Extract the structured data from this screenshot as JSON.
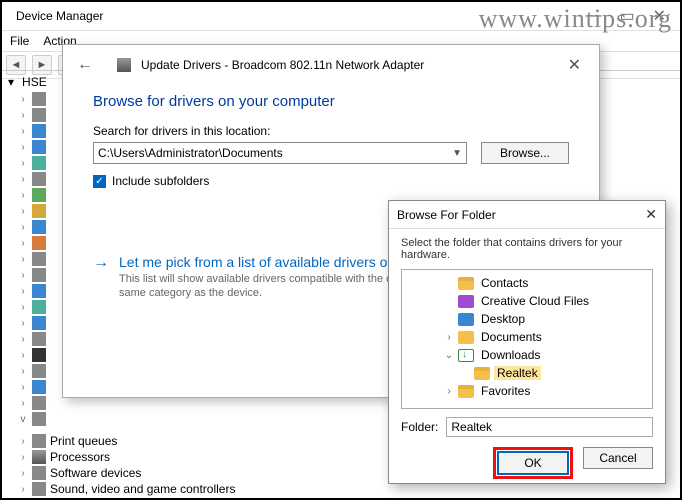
{
  "watermark": "www.wintips.org",
  "device_manager": {
    "title": "Device Manager",
    "menu": [
      "File",
      "Action"
    ],
    "root": "HSE",
    "categories_visible": [
      "Print queues",
      "Processors",
      "Software devices",
      "Sound, video and game controllers"
    ]
  },
  "update_drivers": {
    "header": "Update Drivers - Broadcom 802.11n Network Adapter",
    "heading": "Browse for drivers on your computer",
    "search_label": "Search for drivers in this location:",
    "path": "C:\\Users\\Administrator\\Documents",
    "browse_btn": "Browse...",
    "include_subfolders": "Include subfolders",
    "pick_link": "Let me pick from a list of available drivers on my computer",
    "pick_link_visible": "Let me pick from a list of available drivers o",
    "pick_sub_visible": "This list will show available drivers compatible with the de\nsame category as the device."
  },
  "browse_folder": {
    "title": "Browse For Folder",
    "msg": "Select the folder that contains drivers for your hardware.",
    "tree": [
      {
        "indent": 2,
        "icon": "folder",
        "label": "Contacts",
        "arrow": ""
      },
      {
        "indent": 2,
        "icon": "cloud",
        "label": "Creative Cloud Files",
        "arrow": ""
      },
      {
        "indent": 2,
        "icon": "desk",
        "label": "Desktop",
        "arrow": ""
      },
      {
        "indent": 2,
        "icon": "docs",
        "label": "Documents",
        "arrow": ">"
      },
      {
        "indent": 2,
        "icon": "down",
        "label": "Downloads",
        "arrow": "v"
      },
      {
        "indent": 3,
        "icon": "folder",
        "label": "Realtek",
        "arrow": "",
        "selected": true
      },
      {
        "indent": 2,
        "icon": "folder",
        "label": "Favorites",
        "arrow": ">"
      }
    ],
    "folder_label": "Folder:",
    "folder_value": "Realtek",
    "ok": "OK",
    "cancel": "Cancel"
  }
}
